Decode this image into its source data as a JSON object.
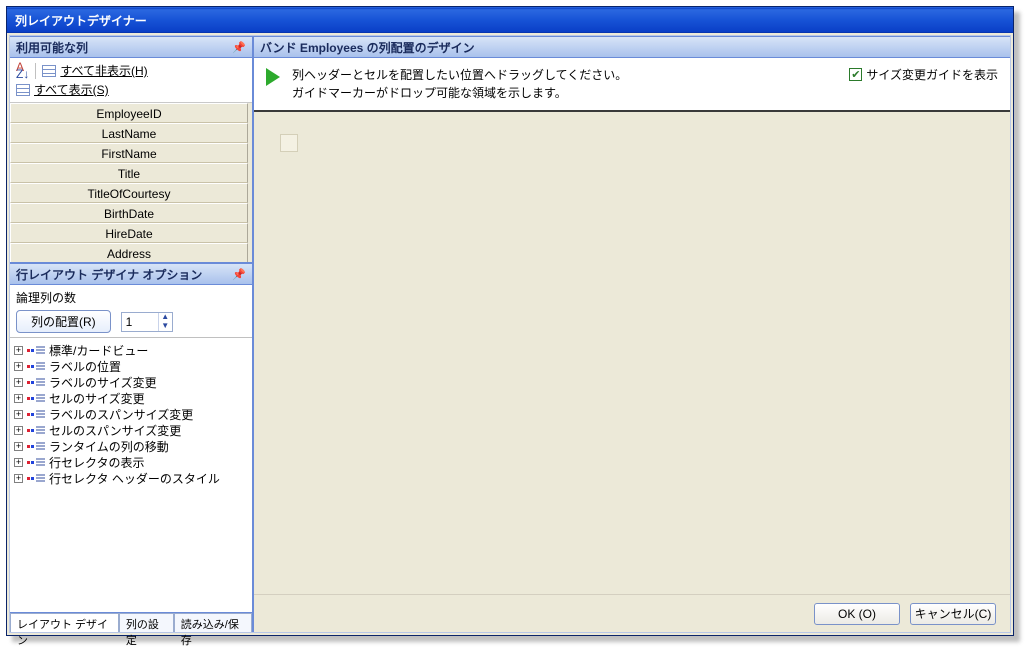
{
  "window": {
    "title": "列レイアウトデザイナー"
  },
  "leftPanel": {
    "header": "利用可能な列",
    "hideAll": "すべて非表示(H)",
    "showAll": "すべて表示(S)",
    "columns": [
      "EmployeeID",
      "LastName",
      "FirstName",
      "Title",
      "TitleOfCourtesy",
      "BirthDate",
      "HireDate",
      "Address"
    ]
  },
  "optionsPanel": {
    "header": "行レイアウト デザイナ オプション",
    "logicalColsLabel": "論理列の数",
    "colArrangeBtn": "列の配置(R)",
    "spinnerValue": "1",
    "treeItems": [
      "標準/カードビュー",
      "ラベルの位置",
      "ラベルのサイズ変更",
      "セルのサイズ変更",
      "ラベルのスパンサイズ変更",
      "セルのスパンサイズ変更",
      "ランタイムの列の移動",
      "行セレクタの表示",
      "行セレクタ ヘッダーのスタイル"
    ]
  },
  "tabs": {
    "items": [
      {
        "label": "レイアウト デザイン"
      },
      {
        "label": "列の設定"
      },
      {
        "label": "読み込み/保存"
      }
    ]
  },
  "rightPanel": {
    "header": "バンド Employees の列配置のデザイン",
    "infoLine1": "列ヘッダーとセルを配置したい位置へドラッグしてください。",
    "infoLine2": "ガイドマーカーがドロップ可能な領域を示します。",
    "guideCheck": "サイズ変更ガイドを表示"
  },
  "footer": {
    "ok": "OK (O)",
    "cancel": "キャンセル(C)"
  }
}
